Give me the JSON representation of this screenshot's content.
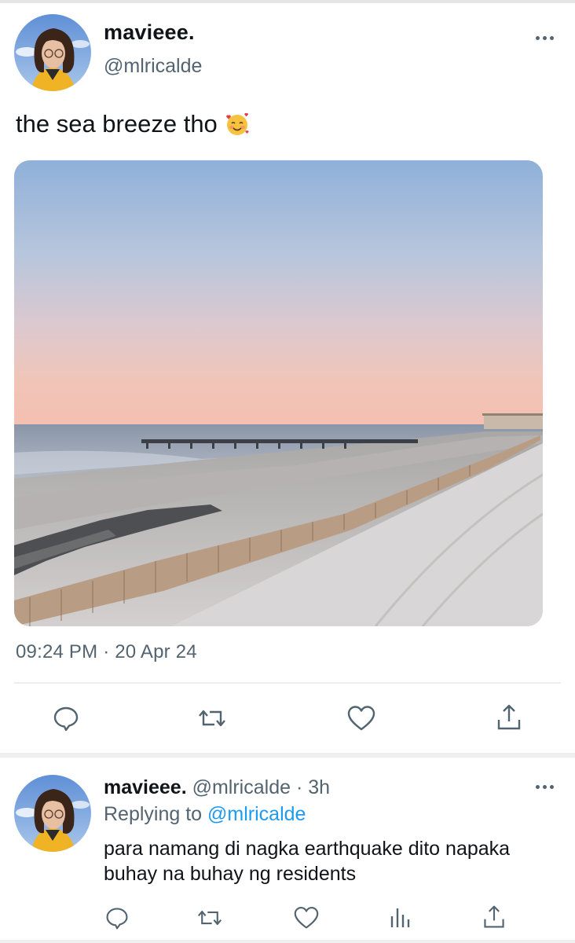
{
  "main_tweet": {
    "author_name": "mavieee.",
    "author_handle": "@mlricalde",
    "text": "the sea breeze tho",
    "emoji": "smiling-face-with-hearts",
    "timestamp": "09:24 PM · 20 Apr 24",
    "actions": [
      "reply-icon",
      "retweet-icon",
      "like-icon",
      "share-icon"
    ]
  },
  "reply": {
    "author_name": "mavieee.",
    "author_handle": "@mlricalde",
    "dot": "·",
    "time_ago": "3h",
    "replying_prefix": "Replying to",
    "replying_to": "@mlricalde",
    "text": "para namang di nagka earthquake dito napaka buhay na buhay ng residents",
    "actions": [
      "reply-icon",
      "retweet-icon",
      "like-icon",
      "views-icon",
      "share-icon"
    ]
  },
  "colors": {
    "text": "#0f1419",
    "secondary": "#536471",
    "link": "#1d9bf0",
    "divider": "#eeeeee"
  }
}
